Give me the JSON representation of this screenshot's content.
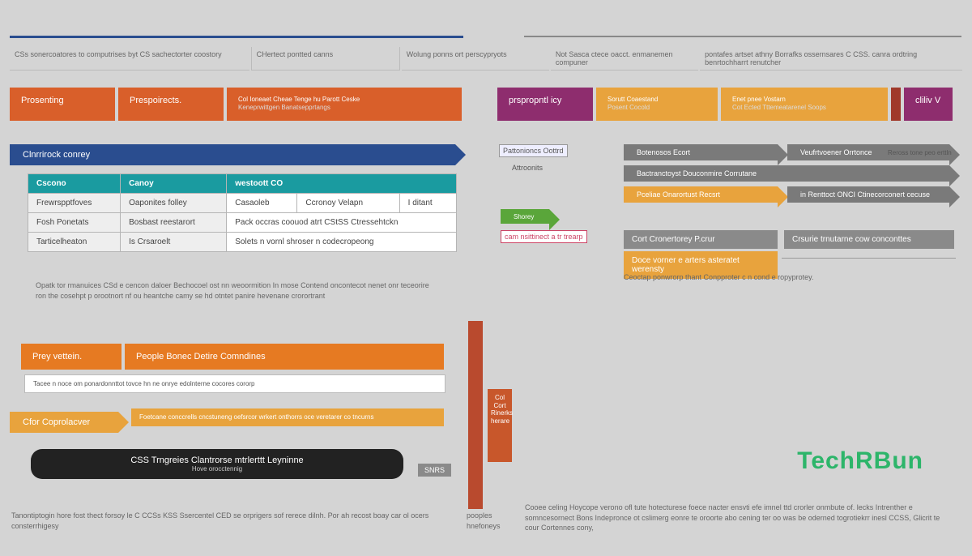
{
  "top_rule": true,
  "headers": {
    "c1": "CSs sonercoatores to computrises byt CS sachectorter coostory",
    "c2": "CHertect pontted canns",
    "c3": "Wolung ponns ort perscypryots",
    "c4": "Not Sasca ctece oacct. enmanemen compuner",
    "c5": "pontafes artset athny Borrafks ossernsares C CSS. canra ordtring benrtochharrt renutcher"
  },
  "row1": {
    "b1": "Prosenting",
    "b2": "Prespoirects.",
    "b3": "Col Ioneaet Cheae Tenge hu Parott Ceske",
    "b3s": "Keneprwittgen Banatsepprtangs",
    "b4": "prspropntl icy",
    "b5": "Sorutt Coaestand",
    "b5s": "Posent Cocold",
    "b6": "Enet pnee Vostarn",
    "b6s": "Cot Ected Tttemeatarenel Soops",
    "b7": "cliliv V"
  },
  "arrow_main": "Clnrrirock conrey",
  "right_arrows": {
    "a1": "Botenosos Ecort",
    "a1b": "Veufrtvoener Orrtonce",
    "a2": "Bactranctoyst Douconmire Corrutane",
    "a3": "Pceliae Onarortust Recsrt",
    "a3b": "in Renttoct ONCI Ctinecorconert cecuse",
    "g1": "Shorey"
  },
  "right_boxes": {
    "r1": "Cort Cronertorey P.crur",
    "r1b": "Crsurie trnutarne cow conconttes",
    "r2": "Doce vorner e arters asteratet werensty",
    "caption": "Ceoctap ponwrorp thant Conpproter c n cond e ropyprotey."
  },
  "tbl": {
    "h1": "Cscono",
    "h2": "Canoy",
    "h3": "westoott CO",
    "r1c1": "Frewrspptfoves",
    "r1c2": "Oaponites folley",
    "r1c3": "Casaoleb",
    "r1c4": "Ccronoy Velapn",
    "r1c5": "I ditant",
    "r2c1": "Fosh Ponetats",
    "r2c2": "Bosbast reestarort",
    "r2c3": "Pack occras coouod atrt CStSS Ctressehtckn",
    "r3c1": "Tarticelheaton",
    "r3c2": "Is Crsaroelt",
    "r3c3": "Solets n vornl shroser n codecropeong"
  },
  "para1": "Opatk tor rmanuices CSd e cencon daloer Bechocoel ost nn weoormition In mose Contend oncontecot nenet onr teceorire ron the cosehpt p orootnort nf ou heantche camy se hd otntet panire hevenane crorortrant",
  "orange_row": {
    "b1": "Prey vettein.",
    "b2": "People Bonec Detire Comndines"
  },
  "thin_text": "Tacee n noce om ponardonnttot tovce hn ne onrye edolnterne cocores cororp",
  "orange_arrow2": {
    "a": "Cfor Coprolacver",
    "b": "Foetcane conccrells cncstuneng oefsrcor wrkert onthorrs oce veretarer co tncurns"
  },
  "thin_col": "Col Cort Rinerks herare",
  "black_bar": {
    "main": "CSS Trngreies Clantrorse mtrlerttt Leyninne",
    "sub": "Hove orocctennig",
    "tag": "SNRS"
  },
  "right_stubs": {
    "s1": "Pattonioncs Oottrd",
    "s2": "Attroonits"
  },
  "bottom_left": "Tanontiptogin hore fost thect forsoy le C CCSs KSS Ssercentel CED se orprigers sof rerece dilnh. Por ah recost boay car ol ocers consterrhigesy",
  "bottom_mid": "pooples hnefoneys",
  "bottom_right": "Cooee celing Hoycope verono ofl tute hotecturese foece nacter ensvti efe imnel ttd crorler onmbute of. lecks Intrenther e somncesornect Bons Indepronce ot cslimerg eonre te oroorte abo cening ter oo was be oderned togrotiekrr inesl CCSS, Glicrit te cour Cortennes cony,",
  "side_label": "Reross tone peo erttln",
  "logo": "TechRBun"
}
